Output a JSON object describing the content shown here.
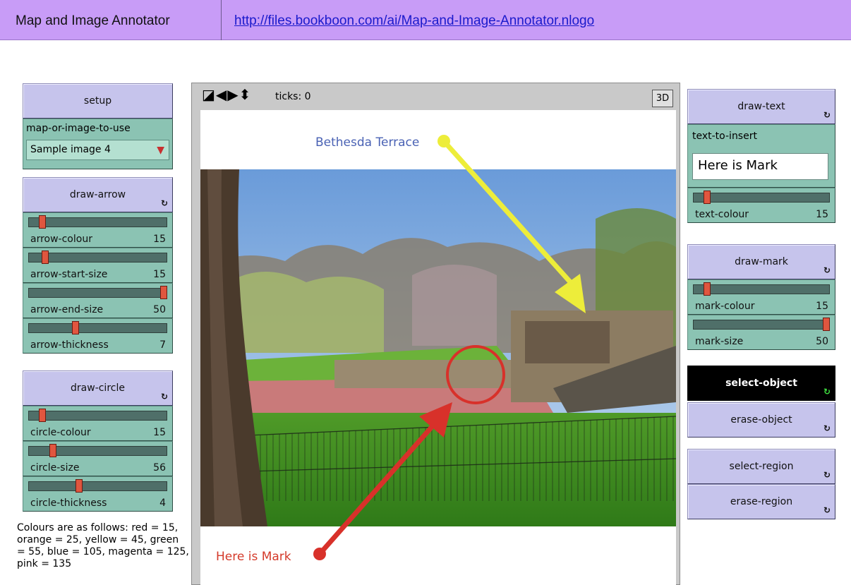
{
  "header": {
    "title": "Map and Image Annotator",
    "link": "http://files.bookboon.com/ai/Map-and-Image-Annotator.nlogo"
  },
  "left_panel": {
    "setup_label": "setup",
    "chooser": {
      "label": "map-or-image-to-use",
      "value": "Sample image 4"
    },
    "draw_arrow": {
      "label": "draw-arrow",
      "sliders": [
        {
          "name": "arrow-colour",
          "value": "15",
          "fraction": 0.08
        },
        {
          "name": "arrow-start-size",
          "value": "15",
          "fraction": 0.1
        },
        {
          "name": "arrow-end-size",
          "value": "50",
          "fraction": 1.0
        },
        {
          "name": "arrow-thickness",
          "value": "7",
          "fraction": 0.33
        }
      ]
    },
    "draw_circle": {
      "label": "draw-circle",
      "sliders": [
        {
          "name": "circle-colour",
          "value": "15",
          "fraction": 0.08
        },
        {
          "name": "circle-size",
          "value": "56",
          "fraction": 0.16
        },
        {
          "name": "circle-thickness",
          "value": "4",
          "fraction": 0.36
        }
      ]
    },
    "note": "Colours are as follows: red = 15, orange = 25, yellow = 45, green = 55, blue = 105, magenta = 125, pink = 135"
  },
  "view": {
    "ticks_label": "ticks: 0",
    "three_d_label": "3D",
    "annotation_top": "Bethesda Terrace",
    "annotation_bottom": "Here is Mark",
    "top_color": "#4a62b4",
    "bottom_color": "#d43a2a",
    "yellow_arrow_color": "#eded3a",
    "red_arrow_color": "#d8312a"
  },
  "right_panel": {
    "draw_text": {
      "label": "draw-text",
      "input_label": "text-to-insert",
      "input_value": "Here is Mark",
      "slider": {
        "name": "text-colour",
        "value": "15",
        "fraction": 0.08
      }
    },
    "draw_mark": {
      "label": "draw-mark",
      "sliders": [
        {
          "name": "mark-colour",
          "value": "15",
          "fraction": 0.08
        },
        {
          "name": "mark-size",
          "value": "50",
          "fraction": 1.0
        }
      ]
    },
    "select_object": "select-object",
    "erase_object": "erase-object",
    "select_region": "select-region",
    "erase_region": "erase-region"
  }
}
